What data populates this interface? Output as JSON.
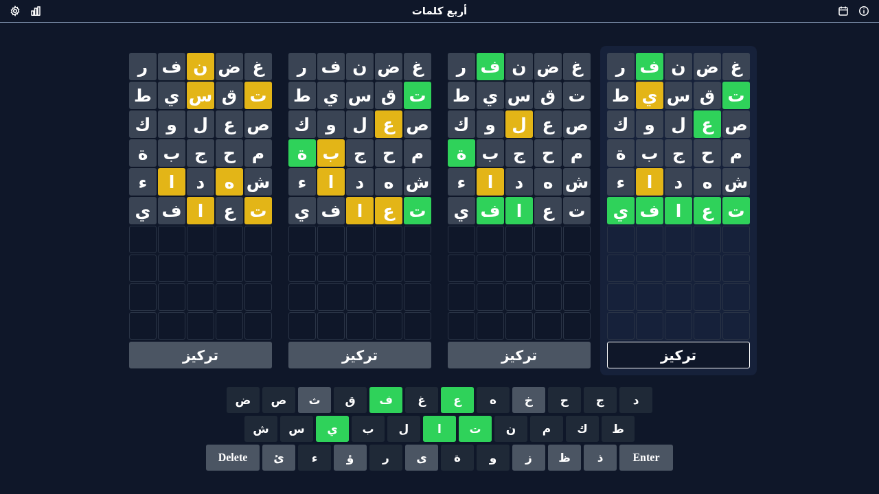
{
  "header": {
    "title": "أربع كلمات"
  },
  "boards": [
    {
      "selected": true,
      "focus_button": "تركيز",
      "rows": [
        {
          "cells": [
            {
              "kind": "letter",
              "letter": "غ",
              "color": "#3a4454"
            },
            {
              "kind": "letter",
              "letter": "ض",
              "color": "#3a4454"
            },
            {
              "kind": "letter",
              "letter": "ن",
              "color": "#3a4454"
            },
            {
              "kind": "letter",
              "letter": "ف",
              "color": "#2fd25a"
            },
            {
              "kind": "letter",
              "letter": "ر",
              "color": "#3a4454"
            }
          ]
        },
        {
          "cells": [
            {
              "kind": "letter",
              "letter": "ت",
              "color": "#2fd25a"
            },
            {
              "kind": "letter",
              "letter": "ق",
              "color": "#3a4454"
            },
            {
              "kind": "letter",
              "letter": "س",
              "color": "#3a4454"
            },
            {
              "kind": "letter",
              "letter": "ي",
              "color": "#e3b517"
            },
            {
              "kind": "letter",
              "letter": "ط",
              "color": "#3a4454"
            }
          ]
        },
        {
          "cells": [
            {
              "kind": "letter",
              "letter": "ص",
              "color": "#3a4454"
            },
            {
              "kind": "letter",
              "letter": "ع",
              "color": "#2fd25a"
            },
            {
              "kind": "letter",
              "letter": "ل",
              "color": "#3a4454"
            },
            {
              "kind": "letter",
              "letter": "و",
              "color": "#3a4454"
            },
            {
              "kind": "letter",
              "letter": "ك",
              "color": "#3a4454"
            }
          ]
        },
        {
          "cells": [
            {
              "kind": "letter",
              "letter": "م",
              "color": "#3a4454"
            },
            {
              "kind": "letter",
              "letter": "ح",
              "color": "#3a4454"
            },
            {
              "kind": "letter",
              "letter": "ج",
              "color": "#3a4454"
            },
            {
              "kind": "letter",
              "letter": "ب",
              "color": "#3a4454"
            },
            {
              "kind": "letter",
              "letter": "ة",
              "color": "#3a4454"
            }
          ]
        },
        {
          "cells": [
            {
              "kind": "letter",
              "letter": "ش",
              "color": "#3a4454"
            },
            {
              "kind": "letter",
              "letter": "ه",
              "color": "#3a4454"
            },
            {
              "kind": "letter",
              "letter": "د",
              "color": "#3a4454"
            },
            {
              "kind": "letter",
              "letter": "ا",
              "color": "#e3b517"
            },
            {
              "kind": "letter",
              "letter": "ء",
              "color": "#3a4454"
            }
          ]
        },
        {
          "cells": [
            {
              "kind": "letter",
              "letter": "ت",
              "color": "#2fd25a"
            },
            {
              "kind": "letter",
              "letter": "ع",
              "color": "#2fd25a"
            },
            {
              "kind": "letter",
              "letter": "ا",
              "color": "#2fd25a"
            },
            {
              "kind": "letter",
              "letter": "ف",
              "color": "#2fd25a"
            },
            {
              "kind": "letter",
              "letter": "ي",
              "color": "#2fd25a"
            }
          ]
        },
        {
          "cells": [
            {
              "kind": "empty"
            },
            {
              "kind": "empty"
            },
            {
              "kind": "empty"
            },
            {
              "kind": "empty"
            },
            {
              "kind": "empty"
            }
          ]
        },
        {
          "cells": [
            {
              "kind": "empty"
            },
            {
              "kind": "empty"
            },
            {
              "kind": "empty"
            },
            {
              "kind": "empty"
            },
            {
              "kind": "empty"
            }
          ]
        },
        {
          "cells": [
            {
              "kind": "empty"
            },
            {
              "kind": "empty"
            },
            {
              "kind": "empty"
            },
            {
              "kind": "empty"
            },
            {
              "kind": "empty"
            }
          ]
        },
        {
          "cells": [
            {
              "kind": "empty"
            },
            {
              "kind": "empty"
            },
            {
              "kind": "empty"
            },
            {
              "kind": "empty"
            },
            {
              "kind": "empty"
            }
          ]
        }
      ]
    },
    {
      "selected": false,
      "focus_button": "تركيز",
      "rows": [
        {
          "cells": [
            {
              "kind": "letter",
              "letter": "غ",
              "color": "#3a4454"
            },
            {
              "kind": "letter",
              "letter": "ض",
              "color": "#3a4454"
            },
            {
              "kind": "letter",
              "letter": "ن",
              "color": "#3a4454"
            },
            {
              "kind": "letter",
              "letter": "ف",
              "color": "#2fd25a"
            },
            {
              "kind": "letter",
              "letter": "ر",
              "color": "#3a4454"
            }
          ]
        },
        {
          "cells": [
            {
              "kind": "letter",
              "letter": "ت",
              "color": "#3a4454"
            },
            {
              "kind": "letter",
              "letter": "ق",
              "color": "#3a4454"
            },
            {
              "kind": "letter",
              "letter": "س",
              "color": "#3a4454"
            },
            {
              "kind": "letter",
              "letter": "ي",
              "color": "#3a4454"
            },
            {
              "kind": "letter",
              "letter": "ط",
              "color": "#3a4454"
            }
          ]
        },
        {
          "cells": [
            {
              "kind": "letter",
              "letter": "ص",
              "color": "#3a4454"
            },
            {
              "kind": "letter",
              "letter": "ع",
              "color": "#3a4454"
            },
            {
              "kind": "letter",
              "letter": "ل",
              "color": "#e3b517"
            },
            {
              "kind": "letter",
              "letter": "و",
              "color": "#3a4454"
            },
            {
              "kind": "letter",
              "letter": "ك",
              "color": "#3a4454"
            }
          ]
        },
        {
          "cells": [
            {
              "kind": "letter",
              "letter": "م",
              "color": "#3a4454"
            },
            {
              "kind": "letter",
              "letter": "ح",
              "color": "#3a4454"
            },
            {
              "kind": "letter",
              "letter": "ج",
              "color": "#3a4454"
            },
            {
              "kind": "letter",
              "letter": "ب",
              "color": "#3a4454"
            },
            {
              "kind": "letter",
              "letter": "ة",
              "color": "#2fd25a"
            }
          ]
        },
        {
          "cells": [
            {
              "kind": "letter",
              "letter": "ش",
              "color": "#3a4454"
            },
            {
              "kind": "letter",
              "letter": "ه",
              "color": "#3a4454"
            },
            {
              "kind": "letter",
              "letter": "د",
              "color": "#3a4454"
            },
            {
              "kind": "letter",
              "letter": "ا",
              "color": "#e3b517"
            },
            {
              "kind": "letter",
              "letter": "ء",
              "color": "#3a4454"
            }
          ]
        },
        {
          "cells": [
            {
              "kind": "letter",
              "letter": "ت",
              "color": "#3a4454"
            },
            {
              "kind": "letter",
              "letter": "ع",
              "color": "#3a4454"
            },
            {
              "kind": "letter",
              "letter": "ا",
              "color": "#2fd25a"
            },
            {
              "kind": "letter",
              "letter": "ف",
              "color": "#2fd25a"
            },
            {
              "kind": "letter",
              "letter": "ي",
              "color": "#3a4454"
            }
          ]
        },
        {
          "cells": [
            {
              "kind": "empty"
            },
            {
              "kind": "empty"
            },
            {
              "kind": "empty"
            },
            {
              "kind": "empty"
            },
            {
              "kind": "empty"
            }
          ]
        },
        {
          "cells": [
            {
              "kind": "empty"
            },
            {
              "kind": "empty"
            },
            {
              "kind": "empty"
            },
            {
              "kind": "empty"
            },
            {
              "kind": "empty"
            }
          ]
        },
        {
          "cells": [
            {
              "kind": "empty"
            },
            {
              "kind": "empty"
            },
            {
              "kind": "empty"
            },
            {
              "kind": "empty"
            },
            {
              "kind": "empty"
            }
          ]
        },
        {
          "cells": [
            {
              "kind": "empty"
            },
            {
              "kind": "empty"
            },
            {
              "kind": "empty"
            },
            {
              "kind": "empty"
            },
            {
              "kind": "empty"
            }
          ]
        }
      ]
    },
    {
      "selected": false,
      "focus_button": "تركيز",
      "rows": [
        {
          "cells": [
            {
              "kind": "letter",
              "letter": "غ",
              "color": "#3a4454"
            },
            {
              "kind": "letter",
              "letter": "ض",
              "color": "#3a4454"
            },
            {
              "kind": "letter",
              "letter": "ن",
              "color": "#3a4454"
            },
            {
              "kind": "letter",
              "letter": "ف",
              "color": "#3a4454"
            },
            {
              "kind": "letter",
              "letter": "ر",
              "color": "#3a4454"
            }
          ]
        },
        {
          "cells": [
            {
              "kind": "letter",
              "letter": "ت",
              "color": "#2fd25a"
            },
            {
              "kind": "letter",
              "letter": "ق",
              "color": "#3a4454"
            },
            {
              "kind": "letter",
              "letter": "س",
              "color": "#3a4454"
            },
            {
              "kind": "letter",
              "letter": "ي",
              "color": "#3a4454"
            },
            {
              "kind": "letter",
              "letter": "ط",
              "color": "#3a4454"
            }
          ]
        },
        {
          "cells": [
            {
              "kind": "letter",
              "letter": "ص",
              "color": "#3a4454"
            },
            {
              "kind": "letter",
              "letter": "ع",
              "color": "#e3b517"
            },
            {
              "kind": "letter",
              "letter": "ل",
              "color": "#3a4454"
            },
            {
              "kind": "letter",
              "letter": "و",
              "color": "#3a4454"
            },
            {
              "kind": "letter",
              "letter": "ك",
              "color": "#3a4454"
            }
          ]
        },
        {
          "cells": [
            {
              "kind": "letter",
              "letter": "م",
              "color": "#3a4454"
            },
            {
              "kind": "letter",
              "letter": "ح",
              "color": "#3a4454"
            },
            {
              "kind": "letter",
              "letter": "ج",
              "color": "#3a4454"
            },
            {
              "kind": "letter",
              "letter": "ب",
              "color": "#e3b517"
            },
            {
              "kind": "letter",
              "letter": "ة",
              "color": "#2fd25a"
            }
          ]
        },
        {
          "cells": [
            {
              "kind": "letter",
              "letter": "ش",
              "color": "#3a4454"
            },
            {
              "kind": "letter",
              "letter": "ه",
              "color": "#3a4454"
            },
            {
              "kind": "letter",
              "letter": "د",
              "color": "#3a4454"
            },
            {
              "kind": "letter",
              "letter": "ا",
              "color": "#e3b517"
            },
            {
              "kind": "letter",
              "letter": "ء",
              "color": "#3a4454"
            }
          ]
        },
        {
          "cells": [
            {
              "kind": "letter",
              "letter": "ت",
              "color": "#2fd25a"
            },
            {
              "kind": "letter",
              "letter": "ع",
              "color": "#e3b517"
            },
            {
              "kind": "letter",
              "letter": "ا",
              "color": "#e3b517"
            },
            {
              "kind": "letter",
              "letter": "ف",
              "color": "#3a4454"
            },
            {
              "kind": "letter",
              "letter": "ي",
              "color": "#3a4454"
            }
          ]
        },
        {
          "cells": [
            {
              "kind": "empty"
            },
            {
              "kind": "empty"
            },
            {
              "kind": "empty"
            },
            {
              "kind": "empty"
            },
            {
              "kind": "empty"
            }
          ]
        },
        {
          "cells": [
            {
              "kind": "empty"
            },
            {
              "kind": "empty"
            },
            {
              "kind": "empty"
            },
            {
              "kind": "empty"
            },
            {
              "kind": "empty"
            }
          ]
        },
        {
          "cells": [
            {
              "kind": "empty"
            },
            {
              "kind": "empty"
            },
            {
              "kind": "empty"
            },
            {
              "kind": "empty"
            },
            {
              "kind": "empty"
            }
          ]
        },
        {
          "cells": [
            {
              "kind": "empty"
            },
            {
              "kind": "empty"
            },
            {
              "kind": "empty"
            },
            {
              "kind": "empty"
            },
            {
              "kind": "empty"
            }
          ]
        }
      ]
    },
    {
      "selected": false,
      "focus_button": "تركيز",
      "rows": [
        {
          "cells": [
            {
              "kind": "letter",
              "letter": "غ",
              "color": "#3a4454"
            },
            {
              "kind": "letter",
              "letter": "ض",
              "color": "#3a4454"
            },
            {
              "kind": "letter",
              "letter": "ن",
              "color": "#e3b517"
            },
            {
              "kind": "letter",
              "letter": "ف",
              "color": "#3a4454"
            },
            {
              "kind": "letter",
              "letter": "ر",
              "color": "#3a4454"
            }
          ]
        },
        {
          "cells": [
            {
              "kind": "letter",
              "letter": "ت",
              "color": "#e3b517"
            },
            {
              "kind": "letter",
              "letter": "ق",
              "color": "#3a4454"
            },
            {
              "kind": "letter",
              "letter": "س",
              "color": "#e3b517"
            },
            {
              "kind": "letter",
              "letter": "ي",
              "color": "#3a4454"
            },
            {
              "kind": "letter",
              "letter": "ط",
              "color": "#3a4454"
            }
          ]
        },
        {
          "cells": [
            {
              "kind": "letter",
              "letter": "ص",
              "color": "#3a4454"
            },
            {
              "kind": "letter",
              "letter": "ع",
              "color": "#3a4454"
            },
            {
              "kind": "letter",
              "letter": "ل",
              "color": "#3a4454"
            },
            {
              "kind": "letter",
              "letter": "و",
              "color": "#3a4454"
            },
            {
              "kind": "letter",
              "letter": "ك",
              "color": "#3a4454"
            }
          ]
        },
        {
          "cells": [
            {
              "kind": "letter",
              "letter": "م",
              "color": "#3a4454"
            },
            {
              "kind": "letter",
              "letter": "ح",
              "color": "#3a4454"
            },
            {
              "kind": "letter",
              "letter": "ج",
              "color": "#3a4454"
            },
            {
              "kind": "letter",
              "letter": "ب",
              "color": "#3a4454"
            },
            {
              "kind": "letter",
              "letter": "ة",
              "color": "#3a4454"
            }
          ]
        },
        {
          "cells": [
            {
              "kind": "letter",
              "letter": "ش",
              "color": "#3a4454"
            },
            {
              "kind": "letter",
              "letter": "ه",
              "color": "#e3b517"
            },
            {
              "kind": "letter",
              "letter": "د",
              "color": "#3a4454"
            },
            {
              "kind": "letter",
              "letter": "ا",
              "color": "#e3b517"
            },
            {
              "kind": "letter",
              "letter": "ء",
              "color": "#3a4454"
            }
          ]
        },
        {
          "cells": [
            {
              "kind": "letter",
              "letter": "ت",
              "color": "#e3b517"
            },
            {
              "kind": "letter",
              "letter": "ع",
              "color": "#3a4454"
            },
            {
              "kind": "letter",
              "letter": "ا",
              "color": "#e3b517"
            },
            {
              "kind": "letter",
              "letter": "ف",
              "color": "#3a4454"
            },
            {
              "kind": "letter",
              "letter": "ي",
              "color": "#3a4454"
            }
          ]
        },
        {
          "cells": [
            {
              "kind": "empty"
            },
            {
              "kind": "empty"
            },
            {
              "kind": "empty"
            },
            {
              "kind": "empty"
            },
            {
              "kind": "empty"
            }
          ]
        },
        {
          "cells": [
            {
              "kind": "empty"
            },
            {
              "kind": "empty"
            },
            {
              "kind": "empty"
            },
            {
              "kind": "empty"
            },
            {
              "kind": "empty"
            }
          ]
        },
        {
          "cells": [
            {
              "kind": "empty"
            },
            {
              "kind": "empty"
            },
            {
              "kind": "empty"
            },
            {
              "kind": "empty"
            },
            {
              "kind": "empty"
            }
          ]
        },
        {
          "cells": [
            {
              "kind": "empty"
            },
            {
              "kind": "empty"
            },
            {
              "kind": "empty"
            },
            {
              "kind": "empty"
            },
            {
              "kind": "empty"
            }
          ]
        }
      ]
    }
  ],
  "keyboard": {
    "rows": [
      {
        "keys": [
          {
            "kind": "letter",
            "label": "د",
            "color": "#1f2937"
          },
          {
            "kind": "letter",
            "label": "ج",
            "color": "#1f2937"
          },
          {
            "kind": "letter",
            "label": "ح",
            "color": "#1f2937"
          },
          {
            "kind": "letter",
            "label": "خ",
            "color": "#4b5563"
          },
          {
            "kind": "letter",
            "label": "ه",
            "color": "#1f2937"
          },
          {
            "kind": "letter",
            "label": "ع",
            "color": "#2fd25a"
          },
          {
            "kind": "letter",
            "label": "غ",
            "color": "#1f2937"
          },
          {
            "kind": "letter",
            "label": "ف",
            "color": "#2fd25a"
          },
          {
            "kind": "letter",
            "label": "ق",
            "color": "#1f2937"
          },
          {
            "kind": "letter",
            "label": "ث",
            "color": "#4b5563"
          },
          {
            "kind": "letter",
            "label": "ص",
            "color": "#1f2937"
          },
          {
            "kind": "letter",
            "label": "ض",
            "color": "#1f2937"
          }
        ]
      },
      {
        "keys": [
          {
            "kind": "letter",
            "label": "ط",
            "color": "#1f2937"
          },
          {
            "kind": "letter",
            "label": "ك",
            "color": "#1f2937"
          },
          {
            "kind": "letter",
            "label": "م",
            "color": "#1f2937"
          },
          {
            "kind": "letter",
            "label": "ن",
            "color": "#1f2937"
          },
          {
            "kind": "letter",
            "label": "ت",
            "color": "#2fd25a"
          },
          {
            "kind": "letter",
            "label": "ا",
            "color": "#2fd25a"
          },
          {
            "kind": "letter",
            "label": "ل",
            "color": "#1f2937"
          },
          {
            "kind": "letter",
            "label": "ب",
            "color": "#1f2937"
          },
          {
            "kind": "letter",
            "label": "ي",
            "color": "#2fd25a"
          },
          {
            "kind": "letter",
            "label": "س",
            "color": "#1f2937"
          },
          {
            "kind": "letter",
            "label": "ش",
            "color": "#1f2937"
          }
        ]
      },
      {
        "keys": [
          {
            "kind": "action",
            "label": "Enter",
            "color": "#4b5563"
          },
          {
            "kind": "letter",
            "label": "ذ",
            "color": "#4b5563"
          },
          {
            "kind": "letter",
            "label": "ظ",
            "color": "#4b5563"
          },
          {
            "kind": "letter",
            "label": "ز",
            "color": "#4b5563"
          },
          {
            "kind": "letter",
            "label": "و",
            "color": "#1f2937"
          },
          {
            "kind": "letter",
            "label": "ة",
            "color": "#1f2937"
          },
          {
            "kind": "letter",
            "label": "ى",
            "color": "#4b5563"
          },
          {
            "kind": "letter",
            "label": "ر",
            "color": "#1f2937"
          },
          {
            "kind": "letter",
            "label": "ؤ",
            "color": "#4b5563"
          },
          {
            "kind": "letter",
            "label": "ء",
            "color": "#1f2937"
          },
          {
            "kind": "letter",
            "label": "ئ",
            "color": "#4b5563"
          },
          {
            "kind": "action",
            "label": "Delete",
            "color": "#4b5563"
          }
        ]
      }
    ]
  }
}
